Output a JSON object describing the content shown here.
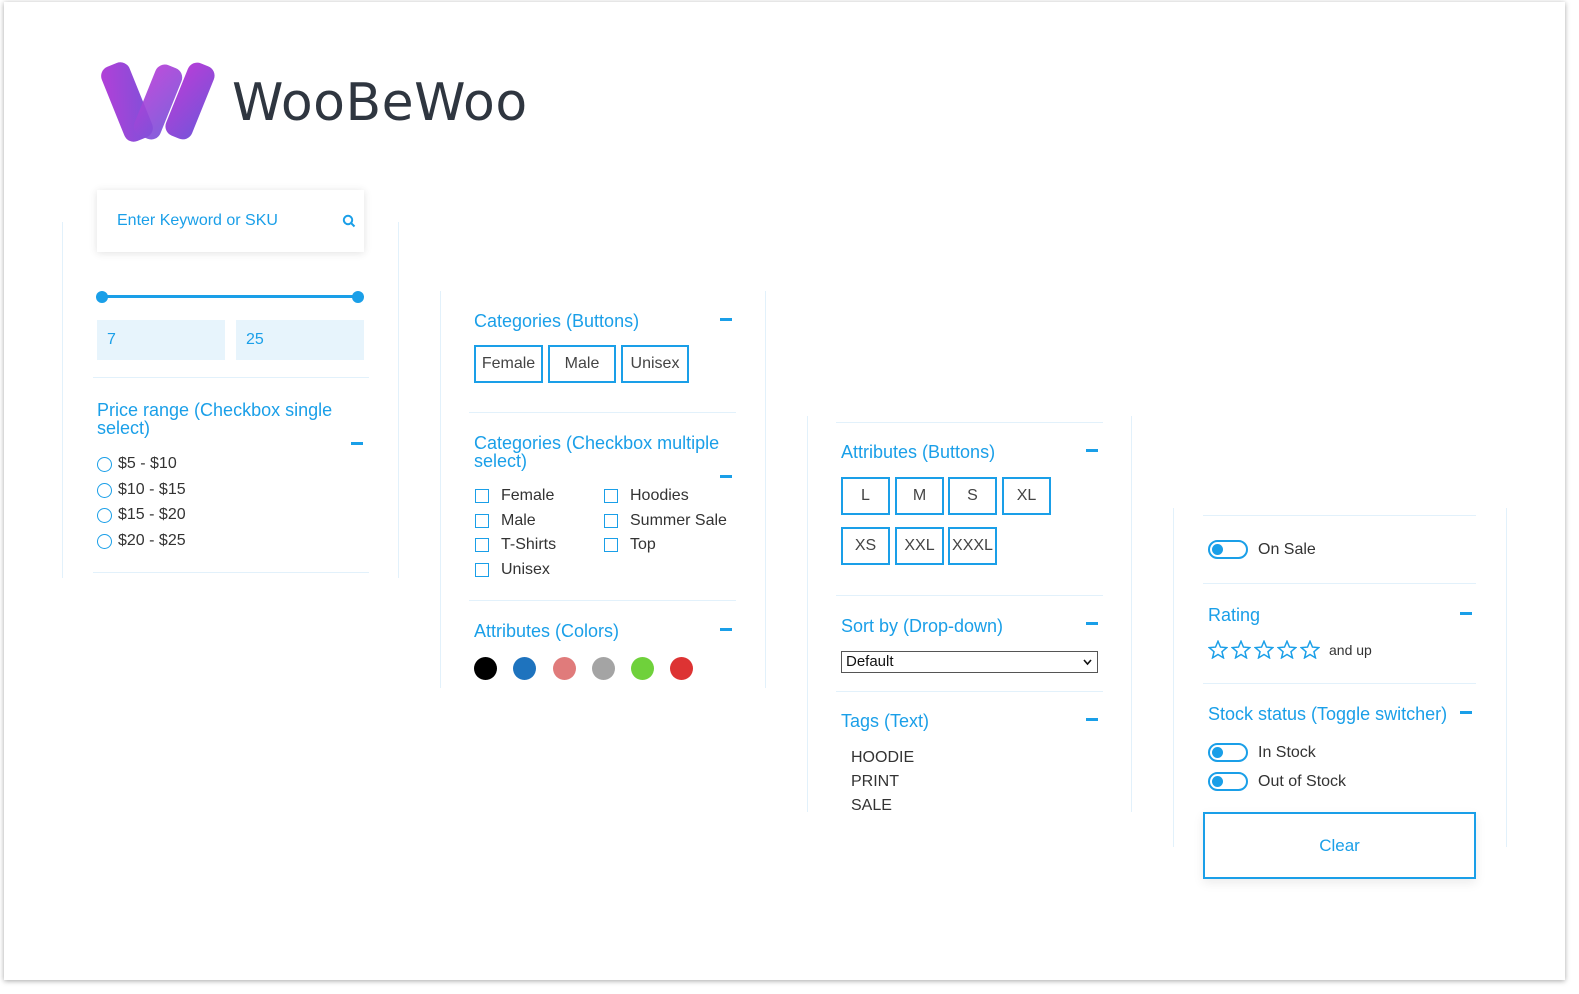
{
  "brand": {
    "name": "WooBeWoo",
    "gradient": [
      "#b33fd6",
      "#7a4fd8"
    ]
  },
  "colors": {
    "accent": "#1a9fe8",
    "divider": "#e2f1fb",
    "field_bg": "#e7f4fc"
  },
  "search": {
    "placeholder": "Enter Keyword or SKU",
    "icon": "search-icon"
  },
  "price_slider": {
    "min_value": "7",
    "max_value": "25"
  },
  "price_range": {
    "title": "Price range (Checkbox single select)",
    "options": [
      "$5 - $10",
      "$10 - $15",
      "$15 - $20",
      "$20 - $25"
    ]
  },
  "categories_buttons": {
    "title": "Categories (Buttons)",
    "items": [
      "Female",
      "Male",
      "Unisex"
    ]
  },
  "categories_checkbox": {
    "title": "Categories (Checkbox multiple select)",
    "col1": [
      "Female",
      "Male",
      "T-Shirts",
      "Unisex"
    ],
    "col2": [
      "Hoodies",
      "Summer Sale",
      "Top"
    ]
  },
  "attributes_colors": {
    "title": "Attributes (Colors)",
    "swatches": [
      "#000000",
      "#1e73be",
      "#e07b7b",
      "#a4a4a4",
      "#6fd13b",
      "#dd3333"
    ]
  },
  "attributes_buttons": {
    "title": "Attributes (Buttons)",
    "row1": [
      "L",
      "M",
      "S",
      "XL"
    ],
    "row2": [
      "XS",
      "XXL",
      "XXXL"
    ]
  },
  "sort_by": {
    "title": "Sort by (Drop-down)",
    "selected": "Default"
  },
  "tags": {
    "title": "Tags (Text)",
    "items": [
      "HOODIE",
      "PRINT",
      "SALE"
    ]
  },
  "on_sale": {
    "label": "On Sale"
  },
  "rating": {
    "title": "Rating",
    "suffix": "and up",
    "stars": 5
  },
  "stock_status": {
    "title": "Stock status (Toggle switcher)",
    "options": [
      "In Stock",
      "Out of Stock"
    ]
  },
  "clear_button": {
    "label": "Clear"
  }
}
